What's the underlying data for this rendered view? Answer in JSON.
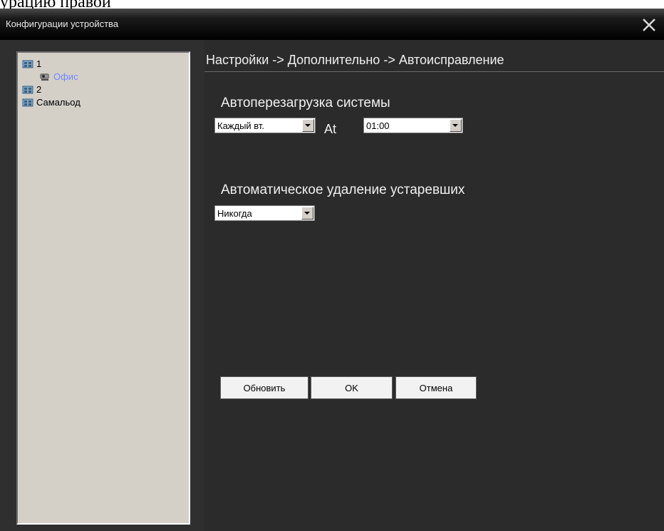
{
  "page_crop_text": "урацию правой ",
  "window": {
    "title": "Конфигурации устройства",
    "close_glyph": "✕"
  },
  "tree": {
    "items": [
      {
        "label": "1",
        "icon": "camera-group-icon"
      },
      {
        "label": "Офис",
        "icon": "camera-icon"
      },
      {
        "label": "2",
        "icon": "camera-group-icon"
      },
      {
        "label": "Самальод",
        "icon": "camera-group-icon"
      }
    ]
  },
  "settings": {
    "breadcrumb": "Настройки -> Дополнительно -> Автоисправление",
    "auto_reboot": {
      "label": "Автоперезагрузка системы",
      "day_value": "Каждый вт.",
      "at_label": "At",
      "time_value": "01:00"
    },
    "auto_delete": {
      "label": "Автоматическое удаление устаревших",
      "value": "Никогда"
    },
    "buttons": {
      "refresh": "Обновить",
      "ok": "OK",
      "cancel": "Отмена"
    }
  },
  "colors": {
    "window_bg": "#2b2b2b",
    "tree_bg": "#d4d0c8",
    "child_label": "#6f88ff",
    "text_light": "#f0f0f0"
  }
}
